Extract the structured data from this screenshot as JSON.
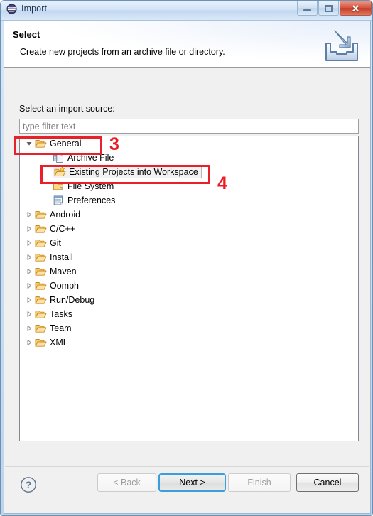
{
  "window": {
    "title": "Import",
    "icon": "eclipse-globe-icon",
    "controls": {
      "minimize_label": "–",
      "maximize_label": "□",
      "close_label": "✕"
    }
  },
  "header": {
    "title": "Select",
    "description": "Create new projects from an archive file or directory.",
    "icon": "import-tray-icon"
  },
  "content": {
    "source_label": "Select an import source:",
    "filter": {
      "value": "",
      "placeholder": "type filter text"
    }
  },
  "tree": {
    "items": [
      {
        "label": "General",
        "level": 1,
        "icon": "open-folder-icon",
        "twisty": "expanded",
        "selected": false
      },
      {
        "label": "Archive File",
        "level": 2,
        "icon": "archive-file-icon",
        "twisty": "none",
        "selected": false
      },
      {
        "label": "Existing Projects into Workspace",
        "level": 2,
        "icon": "open-folder-star-icon",
        "twisty": "none",
        "selected": true
      },
      {
        "label": "File System",
        "level": 2,
        "icon": "folder-icon",
        "twisty": "none",
        "selected": false
      },
      {
        "label": "Preferences",
        "level": 2,
        "icon": "preferences-document-icon",
        "twisty": "none",
        "selected": false
      },
      {
        "label": "Android",
        "level": 1,
        "icon": "open-folder-icon",
        "twisty": "collapsed",
        "selected": false
      },
      {
        "label": "C/C++",
        "level": 1,
        "icon": "open-folder-icon",
        "twisty": "collapsed",
        "selected": false
      },
      {
        "label": "Git",
        "level": 1,
        "icon": "open-folder-icon",
        "twisty": "collapsed",
        "selected": false
      },
      {
        "label": "Install",
        "level": 1,
        "icon": "open-folder-icon",
        "twisty": "collapsed",
        "selected": false
      },
      {
        "label": "Maven",
        "level": 1,
        "icon": "open-folder-icon",
        "twisty": "collapsed",
        "selected": false
      },
      {
        "label": "Oomph",
        "level": 1,
        "icon": "open-folder-icon",
        "twisty": "collapsed",
        "selected": false
      },
      {
        "label": "Run/Debug",
        "level": 1,
        "icon": "open-folder-icon",
        "twisty": "collapsed",
        "selected": false
      },
      {
        "label": "Tasks",
        "level": 1,
        "icon": "open-folder-icon",
        "twisty": "collapsed",
        "selected": false
      },
      {
        "label": "Team",
        "level": 1,
        "icon": "open-folder-icon",
        "twisty": "collapsed",
        "selected": false
      },
      {
        "label": "XML",
        "level": 1,
        "icon": "open-folder-icon",
        "twisty": "collapsed",
        "selected": false
      }
    ]
  },
  "annotations": {
    "color": "#ee1b24",
    "markers": [
      {
        "label": "3",
        "target": "General"
      },
      {
        "label": "4",
        "target": "Existing Projects into Workspace"
      }
    ]
  },
  "buttons": {
    "help_icon": "question-mark-icon",
    "back": {
      "label": "< Back",
      "enabled": false
    },
    "next": {
      "label": "Next >",
      "enabled": true,
      "default": true
    },
    "finish": {
      "label": "Finish",
      "enabled": false
    },
    "cancel": {
      "label": "Cancel",
      "enabled": true
    }
  }
}
